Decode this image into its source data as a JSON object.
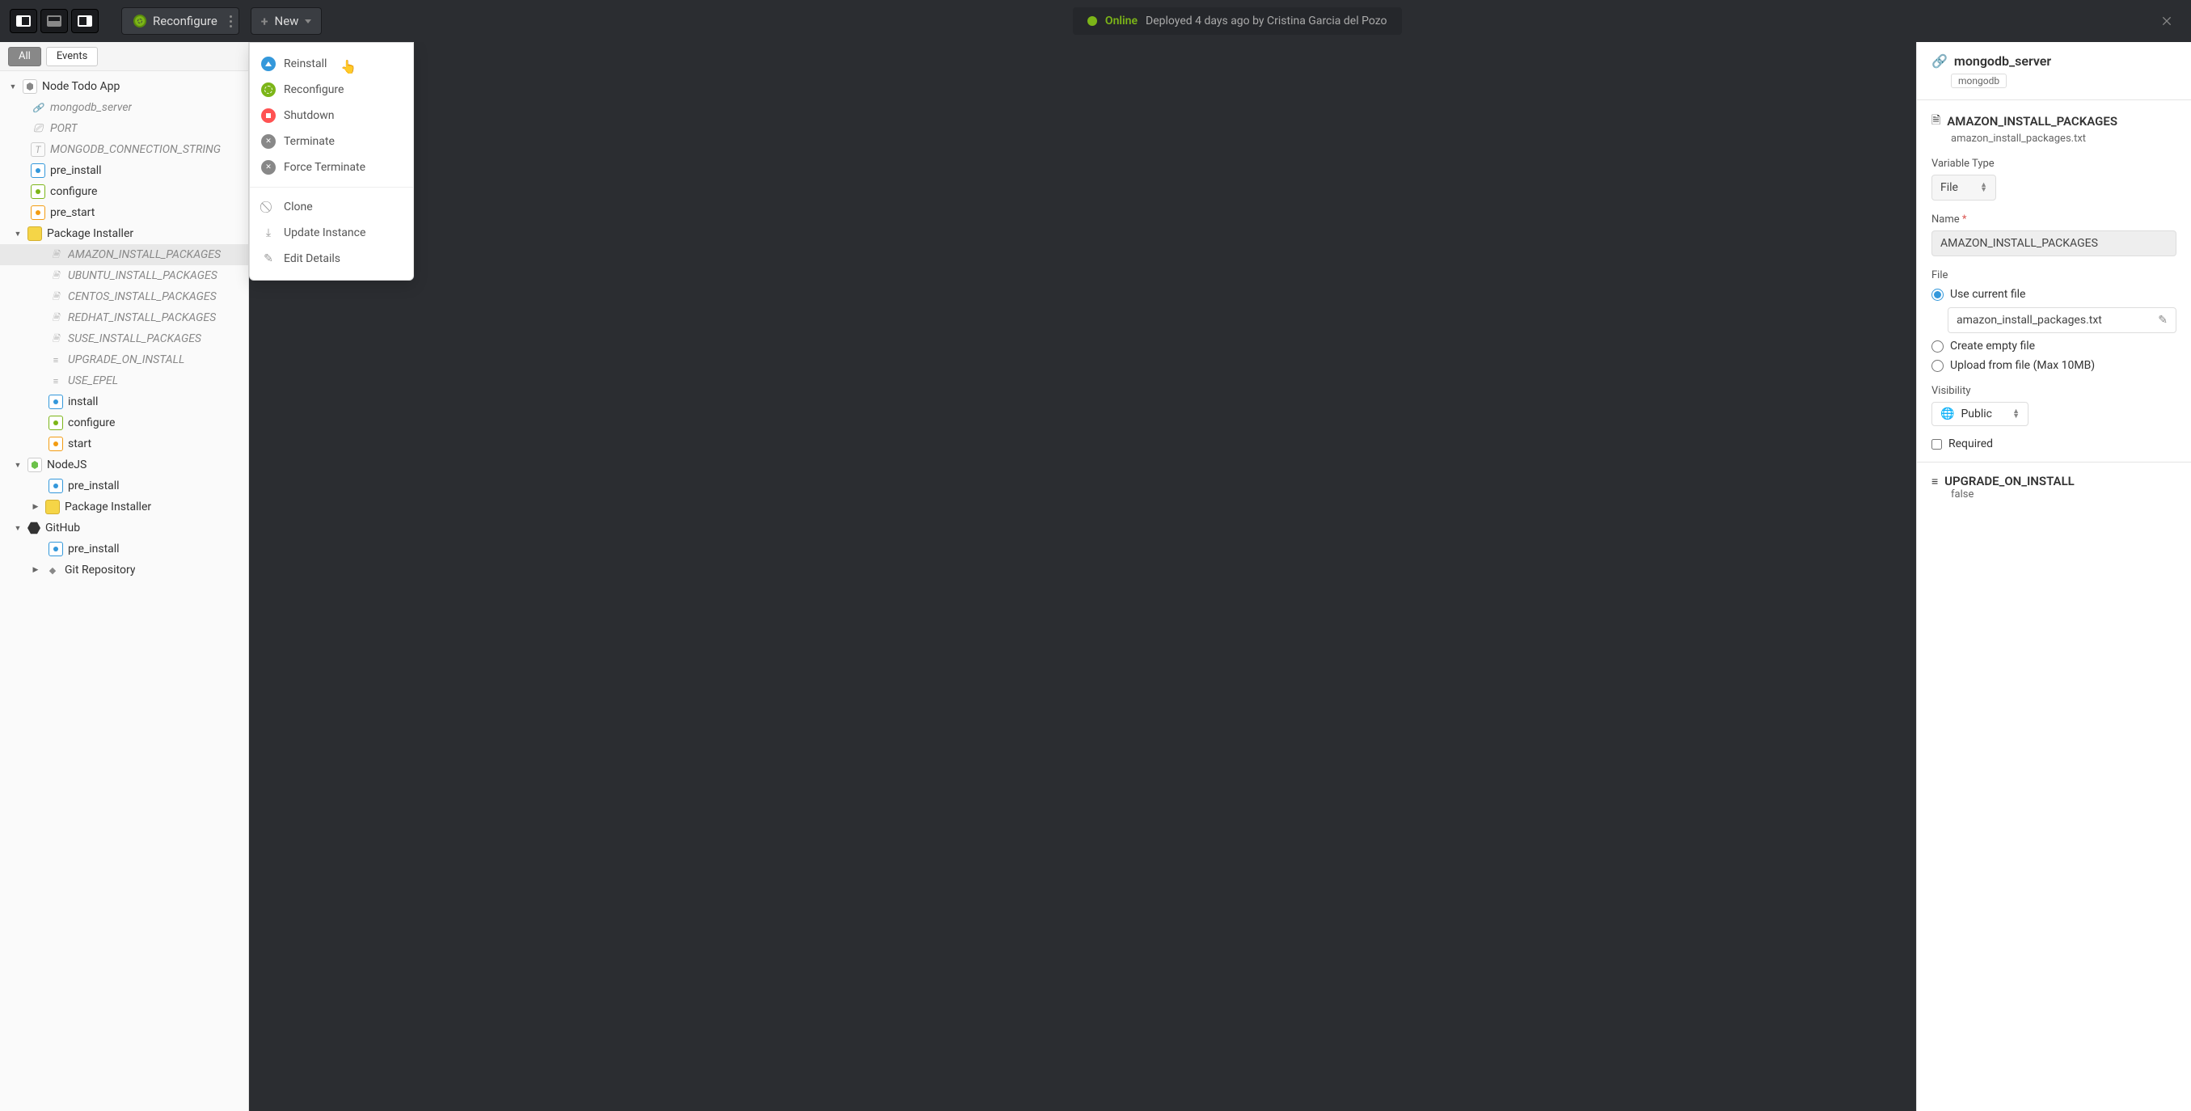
{
  "topbar": {
    "reconfigure_label": "Reconfigure",
    "new_label": "New",
    "status_label": "Online",
    "deploy_text": "Deployed 4 days ago by Cristina Garcia del Pozo"
  },
  "filters": {
    "all": "All",
    "events": "Events"
  },
  "tree": {
    "root": "Node Todo App",
    "mongodb_server": "mongodb_server",
    "port": "PORT",
    "mongo_conn": "MONGODB_CONNECTION_STRING",
    "pre_install": "pre_install",
    "configure": "configure",
    "pre_start": "pre_start",
    "package_installer": "Package Installer",
    "amazon": "AMAZON_INSTALL_PACKAGES",
    "ubuntu": "UBUNTU_INSTALL_PACKAGES",
    "centos": "CENTOS_INSTALL_PACKAGES",
    "redhat": "REDHAT_INSTALL_PACKAGES",
    "suse": "SUSE_INSTALL_PACKAGES",
    "upgrade_on_install": "UPGRADE_ON_INSTALL",
    "use_epel": "USE_EPEL",
    "install": "install",
    "configure2": "configure",
    "start": "start",
    "nodejs": "NodeJS",
    "nodejs_pre_install": "pre_install",
    "nodejs_pkg": "Package Installer",
    "github": "GitHub",
    "github_pre_install": "pre_install",
    "git_repo": "Git Repository"
  },
  "dropdown": {
    "reinstall": "Reinstall",
    "reconfigure": "Reconfigure",
    "shutdown": "Shutdown",
    "terminate": "Terminate",
    "force_terminate": "Force Terminate",
    "clone": "Clone",
    "update_instance": "Update Instance",
    "edit_details": "Edit Details"
  },
  "right": {
    "server_title": "mongodb_server",
    "server_tag": "mongodb",
    "section_title": "AMAZON_INSTALL_PACKAGES",
    "section_file": "amazon_install_packages.txt",
    "variable_type_label": "Variable Type",
    "variable_type_value": "File",
    "name_label": "Name",
    "name_value": "AMAZON_INSTALL_PACKAGES",
    "file_label": "File",
    "use_current_file": "Use current file",
    "current_file_name": "amazon_install_packages.txt",
    "create_empty": "Create empty file",
    "upload_from_file": "Upload from file (Max 10MB)",
    "visibility_label": "Visibility",
    "visibility_value": "Public",
    "required_label": "Required",
    "footer_title": "UPGRADE_ON_INSTALL",
    "footer_value": "false"
  }
}
